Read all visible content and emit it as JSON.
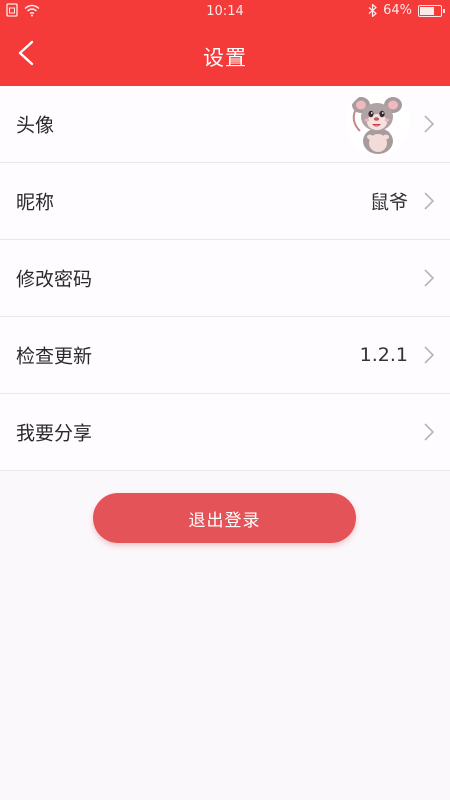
{
  "status_bar": {
    "time": "10:14",
    "battery_text": "64%",
    "battery_level": 0.64,
    "icons": [
      "sim-icon",
      "wifi-icon",
      "bluetooth-icon",
      "battery-icon"
    ]
  },
  "header": {
    "title": "设置",
    "back_icon": "chevron-left-icon",
    "background_color": "#f53a3a"
  },
  "settings": {
    "avatar": {
      "label": "头像",
      "image": "cartoon-mouse-avatar"
    },
    "nickname": {
      "label": "昵称",
      "value": "鼠爷"
    },
    "change_password": {
      "label": "修改密码"
    },
    "check_update": {
      "label": "检查更新",
      "value": "1.2.1"
    },
    "share": {
      "label": "我要分享"
    }
  },
  "logout": {
    "label": "退出登录",
    "color": "#e45357"
  }
}
